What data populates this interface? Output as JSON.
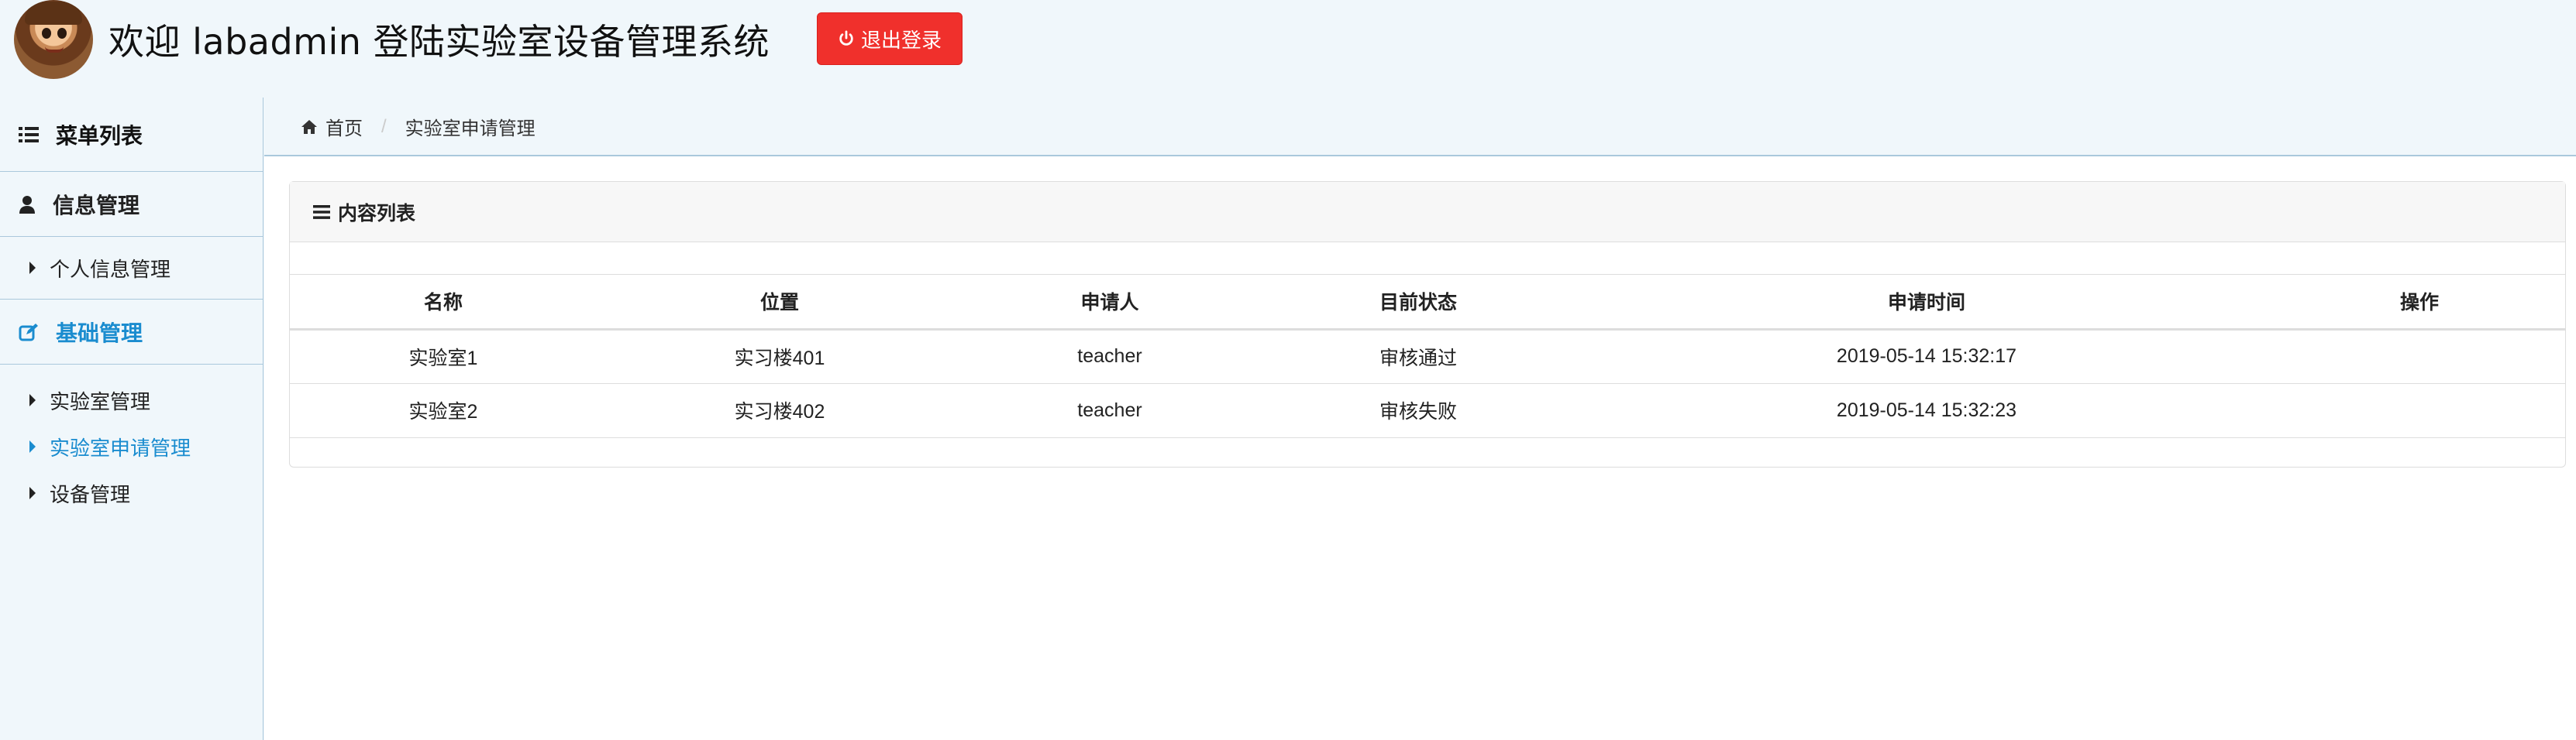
{
  "header": {
    "welcome_text": "欢迎 labadmin 登陆实验室设备管理系统",
    "logout_label": "退出登录",
    "accent_color": "#f0302c"
  },
  "sidebar": {
    "title": "菜单列表",
    "groups": [
      {
        "title": "信息管理",
        "icon": "user-icon",
        "items": [
          {
            "label": "个人信息管理"
          }
        ]
      },
      {
        "title": "基础管理",
        "icon": "edit-icon",
        "active": true,
        "items": [
          {
            "label": "实验室管理"
          },
          {
            "label": "实验室申请管理",
            "active": true
          },
          {
            "label": "设备管理"
          }
        ]
      }
    ],
    "active_color": "#1a8ccf"
  },
  "breadcrumb": {
    "home": "首页",
    "current": "实验室申请管理"
  },
  "panel": {
    "title": "内容列表",
    "columns": [
      "名称",
      "位置",
      "申请人",
      "目前状态",
      "申请时间",
      "操作"
    ],
    "rows": [
      [
        "实验室1",
        "实习楼401",
        "teacher",
        "审核通过",
        "2019-05-14 15:32:17",
        ""
      ],
      [
        "实验室2",
        "实习楼402",
        "teacher",
        "审核失败",
        "2019-05-14 15:32:23",
        ""
      ]
    ]
  }
}
